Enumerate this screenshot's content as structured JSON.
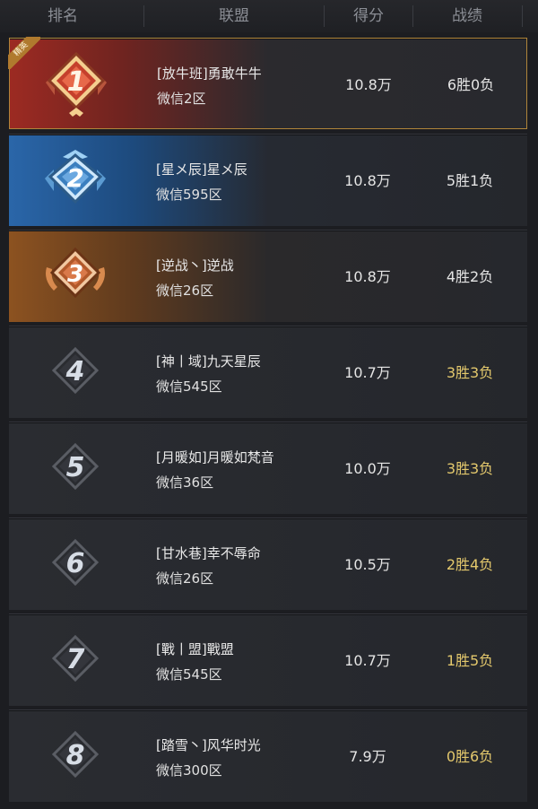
{
  "header": {
    "rank": "排名",
    "alliance": "联盟",
    "score": "得分",
    "record": "战绩"
  },
  "elite_tag": "精英",
  "rows": [
    {
      "rank": "1",
      "name": "[放牛班]勇敢牛牛",
      "server": "微信2区",
      "score": "10.8万",
      "record": "6胜0负",
      "style": "gold",
      "record_color": "white"
    },
    {
      "rank": "2",
      "name": "[星メ辰]星メ辰",
      "server": "微信595区",
      "score": "10.8万",
      "record": "5胜1负",
      "style": "blue",
      "record_color": "white"
    },
    {
      "rank": "3",
      "name": "[逆战丶]逆战",
      "server": "微信26区",
      "score": "10.8万",
      "record": "4胜2负",
      "style": "bronze",
      "record_color": "white"
    },
    {
      "rank": "4",
      "name": "[神丨域]九天星辰",
      "server": "微信545区",
      "score": "10.7万",
      "record": "3胜3负",
      "style": "plain",
      "record_color": "gold"
    },
    {
      "rank": "5",
      "name": "[月暖如]月暖如梵音",
      "server": "微信36区",
      "score": "10.0万",
      "record": "3胜3负",
      "style": "plain",
      "record_color": "gold"
    },
    {
      "rank": "6",
      "name": "[甘水巷]幸不辱命",
      "server": "微信26区",
      "score": "10.5万",
      "record": "2胜4负",
      "style": "plain",
      "record_color": "gold"
    },
    {
      "rank": "7",
      "name": "[戰丨盟]戰盟",
      "server": "微信545区",
      "score": "10.7万",
      "record": "1胜5负",
      "style": "plain",
      "record_color": "gold"
    },
    {
      "rank": "8",
      "name": "[踏雪丶]风华时光",
      "server": "微信300区",
      "score": "7.9万",
      "record": "0胜6负",
      "style": "plain",
      "record_color": "gold"
    }
  ],
  "colors": {
    "gold_accent": "#e3c86c",
    "bg": "#1c1d21"
  }
}
